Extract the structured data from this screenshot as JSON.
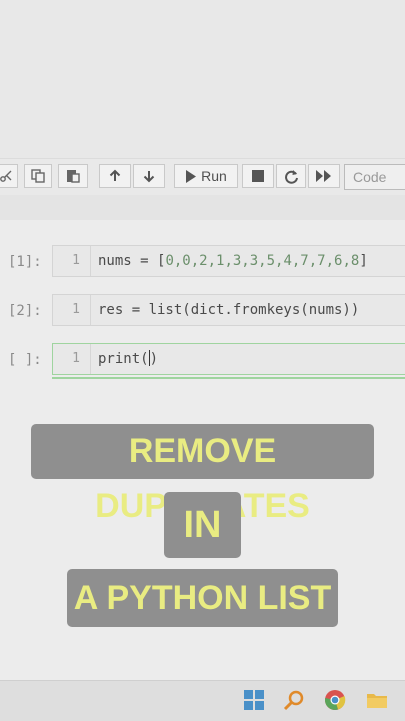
{
  "toolbar": {
    "run_label": "Run",
    "cell_type_placeholder": "Code",
    "icons": [
      "cut-icon",
      "copy-icon",
      "paste-icon",
      "move-up-icon",
      "move-down-icon",
      "run-icon",
      "stop-icon",
      "restart-icon",
      "fast-forward-icon"
    ]
  },
  "cells": [
    {
      "prompt": "[1]:",
      "line": "1",
      "code_var": "nums",
      "code_eq": " = [",
      "code_list": "0,0,2,1,3,3,5,4,7,7,6,8",
      "code_end": "]"
    },
    {
      "prompt": "[2]:",
      "line": "1",
      "code": "res = list(dict.fromkeys(nums))"
    },
    {
      "prompt": "[ ]:",
      "line": "1",
      "code": "print("
    }
  ],
  "overlay": {
    "line1": "REMOVE DUPLICATES",
    "line2": "IN",
    "line3": "A PYTHON LIST",
    "text_color": "#e9ec82",
    "box_color": "#8f8f8f"
  },
  "taskbar": {
    "icons": [
      "windows-start-icon",
      "search-icon",
      "chrome-icon",
      "file-explorer-icon"
    ]
  }
}
